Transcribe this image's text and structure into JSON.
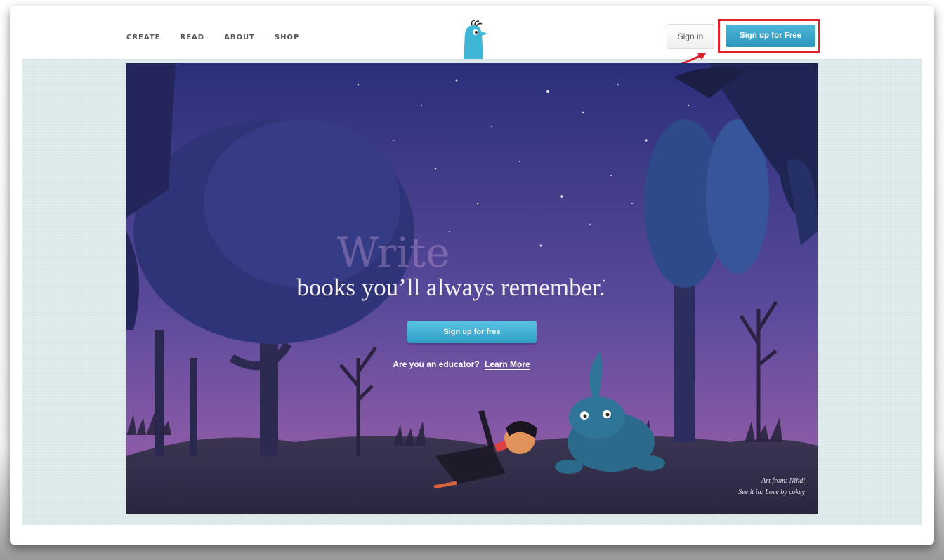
{
  "nav": {
    "items": [
      {
        "label": "CREATE"
      },
      {
        "label": "READ"
      },
      {
        "label": "ABOUT"
      },
      {
        "label": "SHOP"
      }
    ]
  },
  "header": {
    "logo_icon": "bird-logo-icon",
    "signin_label": "Sign in",
    "signup_label": "Sign up for Free"
  },
  "hero": {
    "title": "Write",
    "tagline": "books you’ll always remember.",
    "cta_label": "Sign up for free",
    "educator_prompt": "Are you an educator?",
    "educator_link": "Learn More",
    "art_from_label": "Art from:",
    "art_from_link": "Nihdi",
    "see_it_label": "See it in:",
    "see_it_link": "Love",
    "see_it_by": "by",
    "see_it_author": "cokey"
  },
  "colors": {
    "accent": "#2e95bd",
    "highlight": "#e0202a",
    "sky_top": "#2a2f7a",
    "sky_bottom": "#8a5aa6"
  }
}
